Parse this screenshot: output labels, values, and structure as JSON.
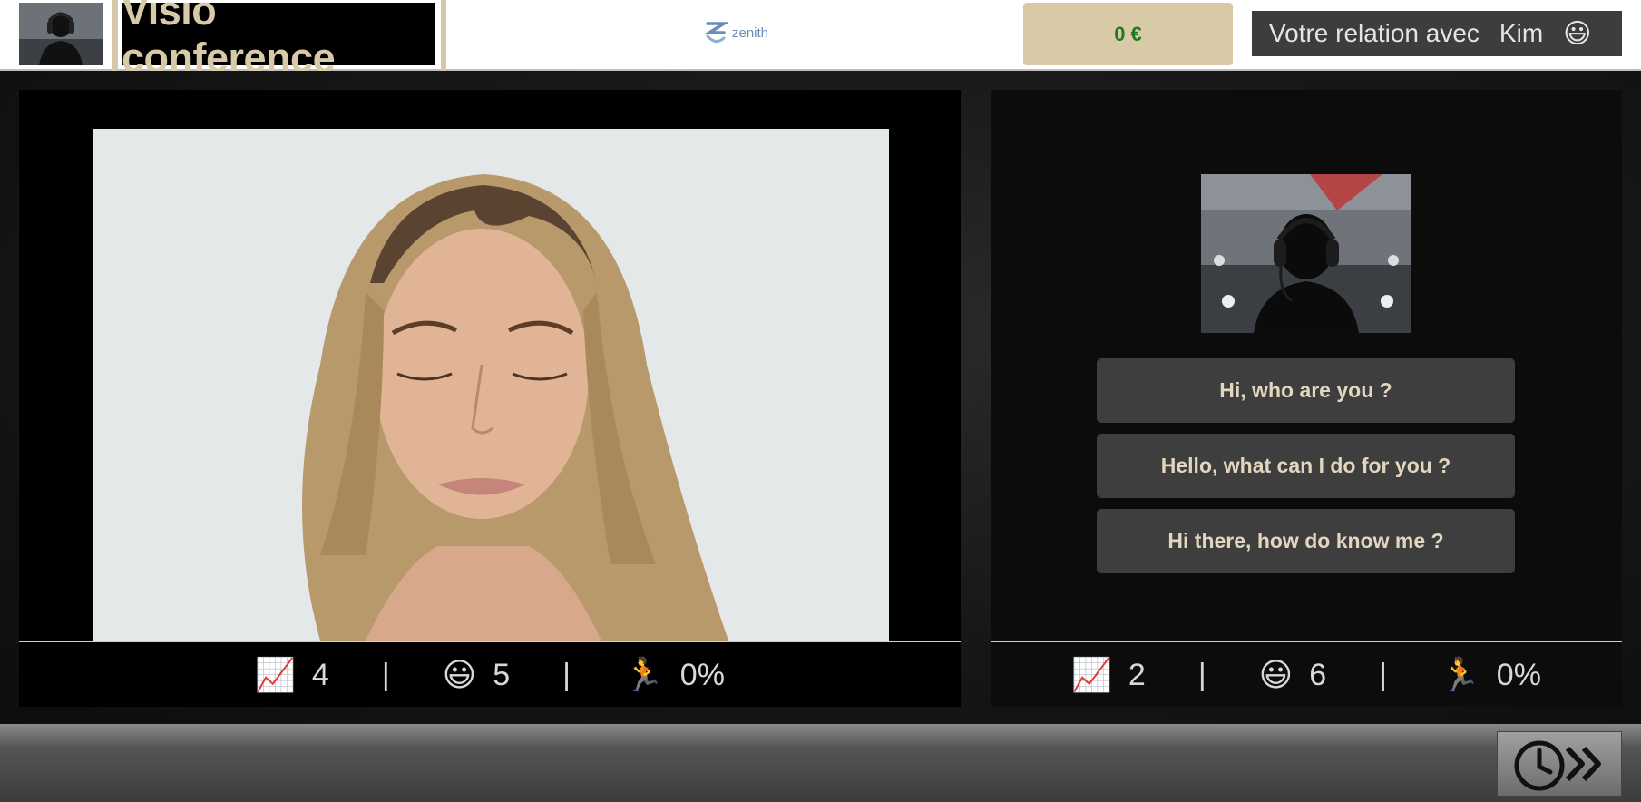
{
  "header": {
    "title": "Visio conference",
    "logo_text": "zenith",
    "money": "0 €",
    "relation_label": "Votre relation avec",
    "relation_name": "Kim",
    "relation_emoji": "😃"
  },
  "left_stats": {
    "trend_icon": "📈",
    "trend_value": "4",
    "mood_icon": "😃",
    "mood_value": "5",
    "run_icon": "🏃",
    "run_value": "0%",
    "separator": "|"
  },
  "right_stats": {
    "trend_icon": "📈",
    "trend_value": "2",
    "mood_icon": "😃",
    "mood_value": "6",
    "run_icon": "🏃",
    "run_value": "0%",
    "separator": "|"
  },
  "choices": [
    {
      "label": "Hi, who are you ?"
    },
    {
      "label": "Hello, what can I do for you ?"
    },
    {
      "label": "Hi there, how do know me ?"
    }
  ],
  "icons": {
    "skip": "clock-fast-forward-icon",
    "trend": "chart-increasing-icon",
    "mood": "smiley-icon",
    "run": "running-person-icon"
  }
}
